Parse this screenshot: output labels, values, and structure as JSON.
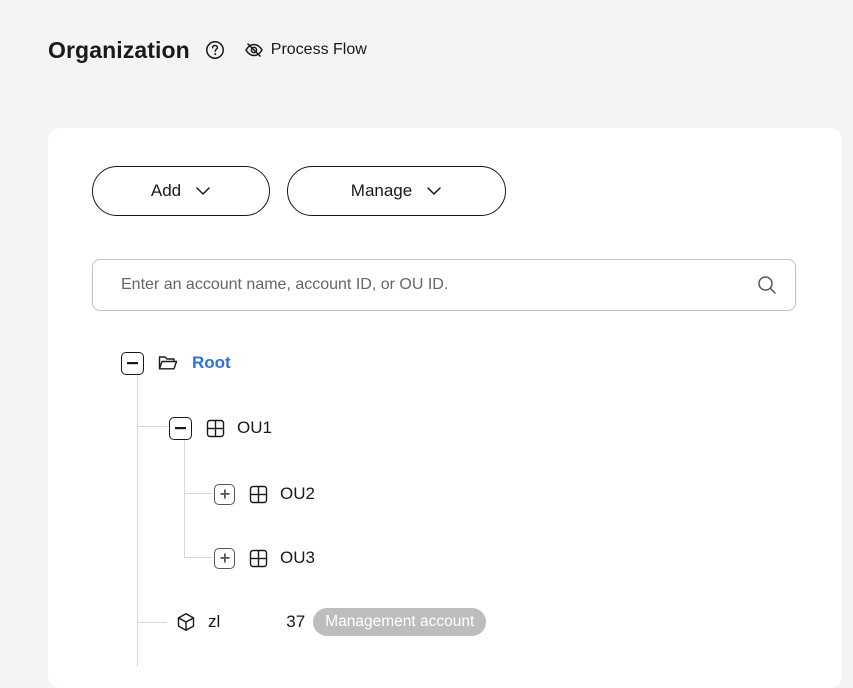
{
  "header": {
    "title": "Organization",
    "help_icon": "question-circle-icon",
    "process_flow_label": "Process Flow",
    "process_flow_icon": "eye-slash-icon"
  },
  "toolbar": {
    "add_label": "Add",
    "manage_label": "Manage"
  },
  "search": {
    "placeholder": "Enter an account name, account ID, or OU ID.",
    "value": ""
  },
  "tree": {
    "root": {
      "label": "Root",
      "state": "expanded",
      "icon": "folder-open-icon",
      "color": "#2f6fe4"
    },
    "ou1": {
      "label": "OU1",
      "state": "expanded",
      "icon": "ou-grid-icon"
    },
    "ou2": {
      "label": "OU2",
      "state": "collapsed",
      "icon": "ou-grid-icon"
    },
    "ou3": {
      "label": "OU3",
      "state": "collapsed",
      "icon": "ou-grid-icon"
    },
    "account": {
      "name_prefix": "zl",
      "name_suffix": "37",
      "icon": "cube-icon",
      "badge": "Management account"
    }
  }
}
